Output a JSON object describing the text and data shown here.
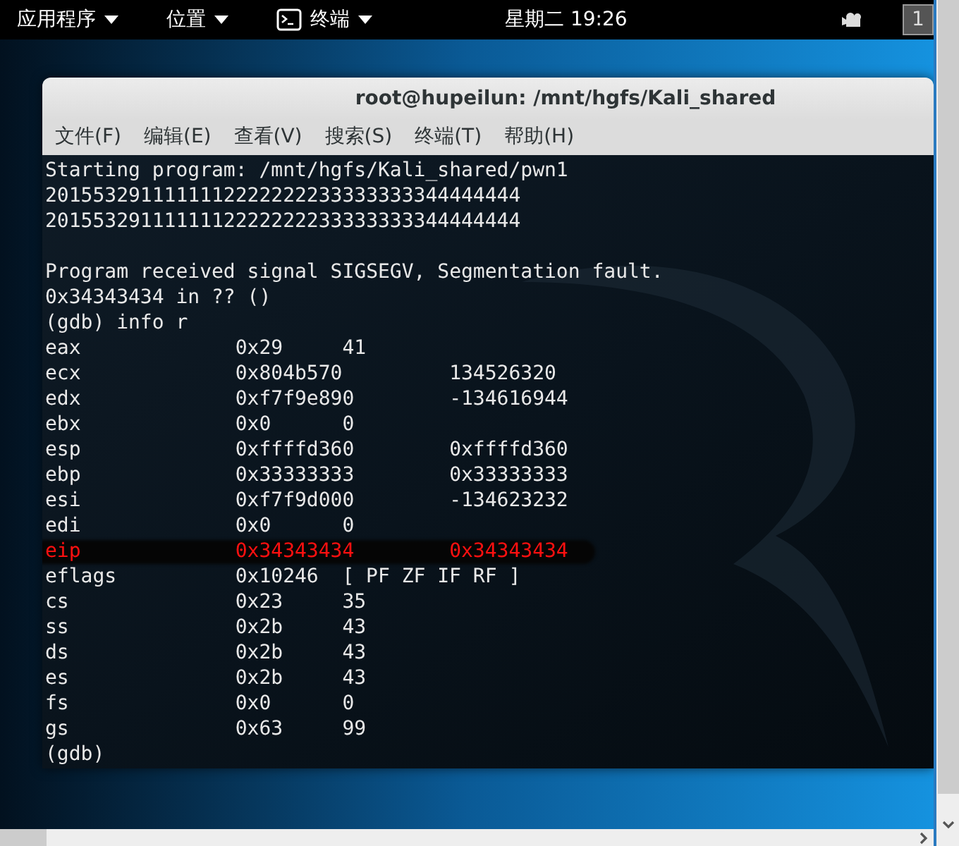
{
  "top_bar": {
    "menus": [
      {
        "label": "应用程序",
        "kind": "plain"
      },
      {
        "label": "位置",
        "kind": "plain"
      },
      {
        "label": "终端",
        "kind": "app"
      }
    ],
    "clock": "星期二 19:26",
    "workspace": "1"
  },
  "window": {
    "title": "root@hupeilun: /mnt/hgfs/Kali_shared"
  },
  "menu_bar": [
    "文件(F)",
    "编辑(E)",
    "查看(V)",
    "搜索(S)",
    "终端(T)",
    "帮助(H)"
  ],
  "terminal": {
    "lines": [
      {
        "kind": "text",
        "text": "Starting program: /mnt/hgfs/Kali_shared/pwn1"
      },
      {
        "kind": "text",
        "text": "2015532911111112222222233333333344444444"
      },
      {
        "kind": "text",
        "text": "2015532911111112222222233333333344444444"
      },
      {
        "kind": "blank"
      },
      {
        "kind": "text",
        "text": "Program received signal SIGSEGV, Segmentation fault."
      },
      {
        "kind": "text",
        "text": "0x34343434 in ?? ()"
      },
      {
        "kind": "text",
        "text": "(gdb) info r"
      },
      {
        "kind": "register",
        "name": "eax",
        "hex": "0x29",
        "value": "41",
        "highlighted": false
      },
      {
        "kind": "register",
        "name": "ecx",
        "hex": "0x804b570",
        "value": "134526320",
        "highlighted": false
      },
      {
        "kind": "register",
        "name": "edx",
        "hex": "0xf7f9e890",
        "value": "-134616944",
        "highlighted": false
      },
      {
        "kind": "register",
        "name": "ebx",
        "hex": "0x0",
        "value": "0",
        "highlighted": false
      },
      {
        "kind": "register",
        "name": "esp",
        "hex": "0xffffd360",
        "value": "0xffffd360",
        "highlighted": false
      },
      {
        "kind": "register",
        "name": "ebp",
        "hex": "0x33333333",
        "value": "0x33333333",
        "highlighted": false
      },
      {
        "kind": "register",
        "name": "esi",
        "hex": "0xf7f9d000",
        "value": "-134623232",
        "highlighted": false
      },
      {
        "kind": "register",
        "name": "edi",
        "hex": "0x0",
        "value": "0",
        "highlighted": false
      },
      {
        "kind": "register",
        "name": "eip",
        "hex": "0x34343434",
        "value": "0x34343434",
        "highlighted": true
      },
      {
        "kind": "register",
        "name": "eflags",
        "hex": "0x10246",
        "value": "[ PF ZF IF RF ]",
        "highlighted": false
      },
      {
        "kind": "register",
        "name": "cs",
        "hex": "0x23",
        "value": "35",
        "highlighted": false
      },
      {
        "kind": "register",
        "name": "ss",
        "hex": "0x2b",
        "value": "43",
        "highlighted": false
      },
      {
        "kind": "register",
        "name": "ds",
        "hex": "0x2b",
        "value": "43",
        "highlighted": false
      },
      {
        "kind": "register",
        "name": "es",
        "hex": "0x2b",
        "value": "43",
        "highlighted": false
      },
      {
        "kind": "register",
        "name": "fs",
        "hex": "0x0",
        "value": "0",
        "highlighted": false
      },
      {
        "kind": "register",
        "name": "gs",
        "hex": "0x63",
        "value": "99",
        "highlighted": false
      },
      {
        "kind": "text",
        "text": "(gdb)"
      }
    ]
  }
}
